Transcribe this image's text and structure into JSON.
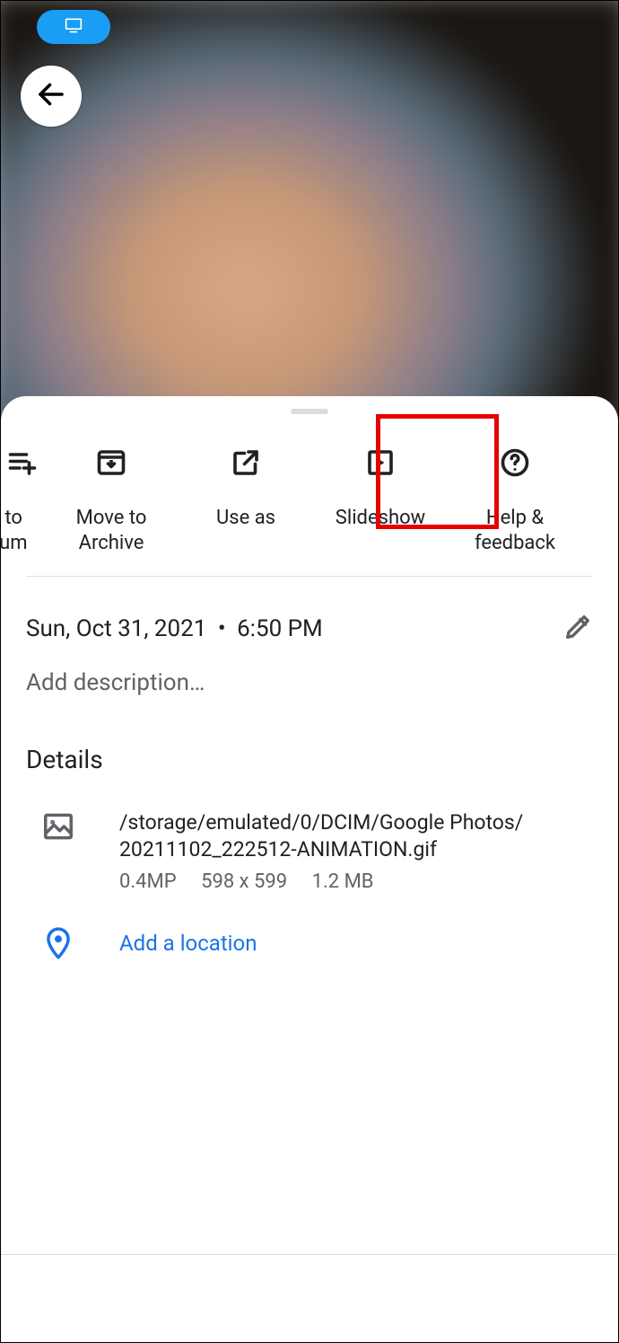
{
  "actions": {
    "add_to_album": "dd to album",
    "move_to_archive": "Move to Archive",
    "use_as": "Use as",
    "slideshow": "Slideshow",
    "help_feedback": "Help &\nfeedback"
  },
  "meta": {
    "date": "Sun, Oct 31, 2021",
    "time": "6:50 PM",
    "description_placeholder": "Add description…"
  },
  "details": {
    "heading": "Details",
    "file": {
      "path_line1": "/storage/emulated/0/DCIM/Google Photos/",
      "path_line2": "20211102_222512-ANIMATION.gif",
      "megapixels": "0.4MP",
      "dimensions": "598 x 599",
      "size": "1.2 MB"
    },
    "location_link": "Add a location"
  }
}
